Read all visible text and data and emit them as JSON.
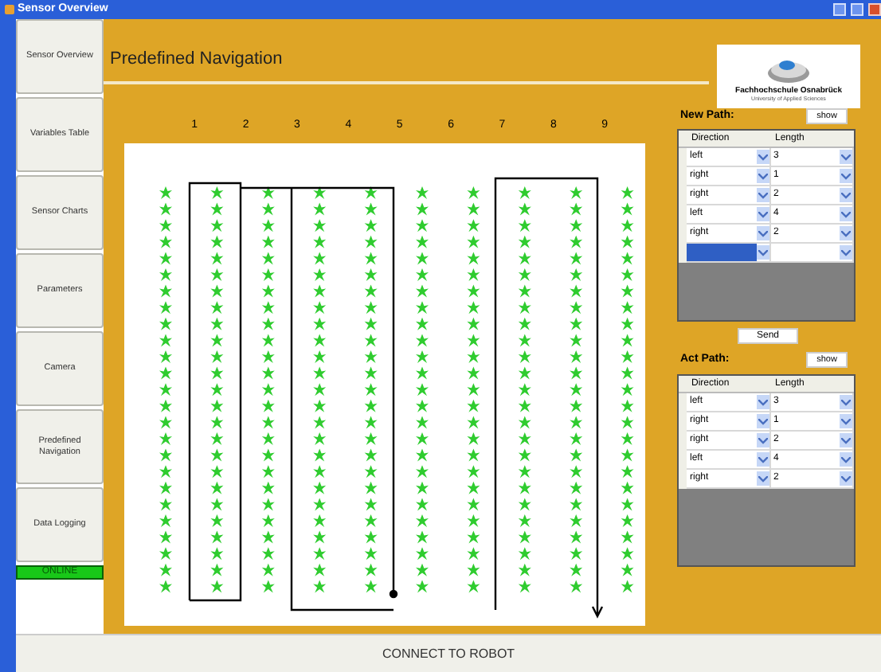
{
  "window": {
    "title": "Sensor Overview"
  },
  "nav": {
    "items": [
      {
        "label": "Sensor Overview"
      },
      {
        "label": "Variables Table"
      },
      {
        "label": "Sensor Charts"
      },
      {
        "label": "Parameters"
      },
      {
        "label": "Camera"
      },
      {
        "label": "Predefined Navigation"
      },
      {
        "label": "Data Logging"
      }
    ],
    "status": "ONLINE"
  },
  "heading": "Predefined Navigation",
  "logo": {
    "name": "Fachhochschule Osnabrück",
    "subtitle": "University of Applied Sciences"
  },
  "field": {
    "columns": [
      "1",
      "2",
      "3",
      "4",
      "5",
      "6",
      "7",
      "8",
      "9"
    ]
  },
  "new_path": {
    "label": "New Path:",
    "show_button": "show",
    "columns": [
      "Direction",
      "Length"
    ],
    "rows": [
      {
        "direction": "left",
        "length": "3"
      },
      {
        "direction": "right",
        "length": "1"
      },
      {
        "direction": "right",
        "length": "2"
      },
      {
        "direction": "left",
        "length": "4"
      },
      {
        "direction": "right",
        "length": "2"
      }
    ],
    "new_row": {
      "selected": true
    },
    "send_button": "Send"
  },
  "act_path": {
    "label": "Act Path:",
    "show_button": "show",
    "columns": [
      "Direction",
      "Length"
    ],
    "rows": [
      {
        "direction": "left",
        "length": "3"
      },
      {
        "direction": "right",
        "length": "1"
      },
      {
        "direction": "right",
        "length": "2"
      },
      {
        "direction": "left",
        "length": "4"
      },
      {
        "direction": "right",
        "length": "2"
      }
    ]
  },
  "connect_button": "CONNECT TO ROBOT"
}
